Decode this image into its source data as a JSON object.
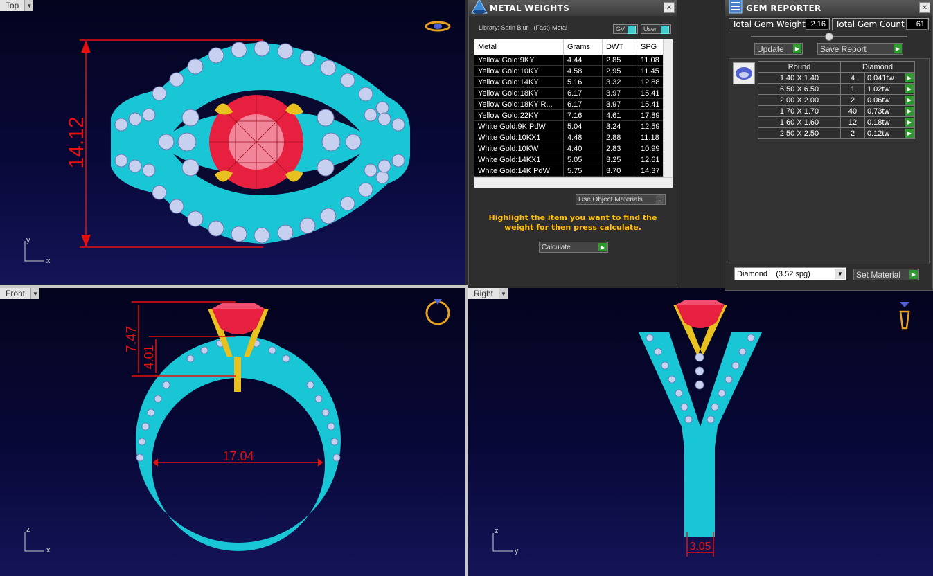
{
  "viewports": {
    "top": {
      "label": "Top",
      "dim_height": "14.12",
      "axis_v": "y",
      "axis_h": "x"
    },
    "front": {
      "label": "Front",
      "dim_inner": "17.04",
      "dim_total": "7.47",
      "dim_head": "4.01",
      "axis_v": "z",
      "axis_h": "x"
    },
    "right": {
      "label": "Right",
      "dim_shank": "3.05",
      "axis_v": "z",
      "axis_h": "y"
    }
  },
  "metal_weights": {
    "title": "METAL WEIGHTS",
    "library": "Library: Satin Blur - (Fast)-Metal",
    "gv_label": "GV",
    "user_label": "User",
    "columns": [
      "Metal",
      "Grams",
      "DWT",
      "SPG"
    ],
    "rows": [
      [
        "Yellow Gold:9KY",
        "4.44",
        "2.85",
        "11.08"
      ],
      [
        "Yellow Gold:10KY",
        "4.58",
        "2.95",
        "11.45"
      ],
      [
        "Yellow Gold:14KY",
        "5.16",
        "3.32",
        "12.88"
      ],
      [
        "Yellow Gold:18KY",
        "6.17",
        "3.97",
        "15.41"
      ],
      [
        "Yellow Gold:18KY R...",
        "6.17",
        "3.97",
        "15.41"
      ],
      [
        "Yellow Gold:22KY",
        "7.16",
        "4.61",
        "17.89"
      ],
      [
        "White Gold:9K PdW",
        "5.04",
        "3.24",
        "12.59"
      ],
      [
        "White Gold:10KX1",
        "4.48",
        "2.88",
        "11.18"
      ],
      [
        "White Gold:10KW",
        "4.40",
        "2.83",
        "10.99"
      ],
      [
        "White Gold:14KX1",
        "5.05",
        "3.25",
        "12.61"
      ],
      [
        "White Gold:14K PdW",
        "5.75",
        "3.70",
        "14.37"
      ]
    ],
    "use_object_materials": "Use Object Materials",
    "hint": "Highlight the item you want to find the weight for then press calculate.",
    "calculate": "Calculate"
  },
  "gem_reporter": {
    "title": "GEM REPORTER",
    "total_weight_label": "Total Gem Weight",
    "total_weight": "2.16",
    "total_count_label": "Total Gem Count",
    "total_count": "61",
    "update": "Update",
    "save_report": "Save Report",
    "col_shape": "Round",
    "col_material": "Diamond",
    "rows": [
      [
        "1.40 X 1.40",
        "4",
        "0.041tw"
      ],
      [
        "6.50 X 6.50",
        "1",
        "1.02tw"
      ],
      [
        "2.00 X 2.00",
        "2",
        "0.06tw"
      ],
      [
        "1.70 X 1.70",
        "40",
        "0.73tw"
      ],
      [
        "1.60 X 1.60",
        "12",
        "0.18tw"
      ],
      [
        "2.50 X 2.50",
        "2",
        "0.12tw"
      ]
    ],
    "material_select": "Diamond    (3.52 spg)",
    "set_material": "Set Material"
  },
  "colors": {
    "band": "#1ec8d8",
    "gold": "#e8c020",
    "ruby": "#e8203c",
    "dimension": "#e61010"
  }
}
